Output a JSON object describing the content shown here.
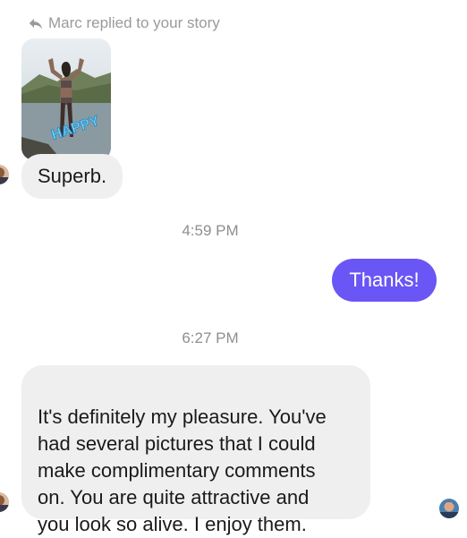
{
  "reply_header": {
    "icon": "reply-arrow-icon",
    "text": "Marc replied to your story"
  },
  "story_thumbnail": {
    "sticker_text": "HAPPY"
  },
  "messages": [
    {
      "direction": "incoming",
      "text": "Superb."
    },
    {
      "type": "timestamp",
      "text": "4:59 PM"
    },
    {
      "direction": "outgoing",
      "text": "Thanks!"
    },
    {
      "type": "timestamp",
      "text": "6:27 PM"
    },
    {
      "direction": "incoming",
      "text": "It's definitely my pleasure. You've\nhad several pictures that I could\nmake  complimentary comments\non. You are quite attractive and\nyou look so alive. I enjoy them."
    }
  ],
  "colors": {
    "outgoing_bubble": "#6a55f5",
    "incoming_bubble": "#efefef",
    "timestamp": "#8e8e8e"
  }
}
